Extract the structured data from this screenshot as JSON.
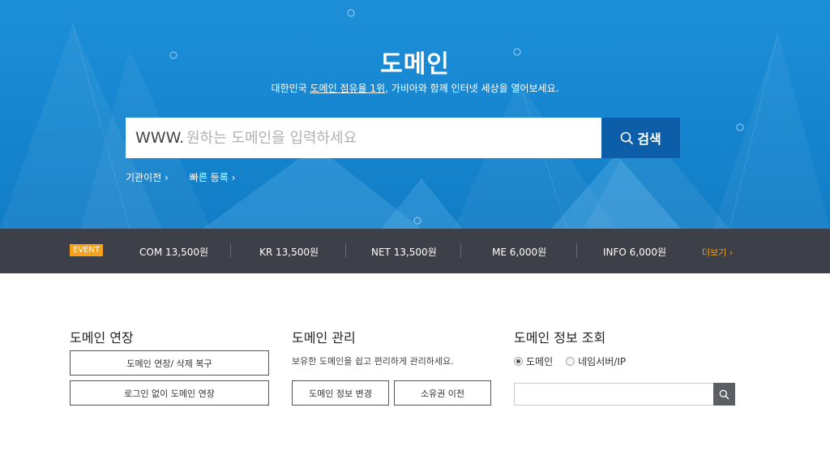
{
  "hero": {
    "title": "도메인",
    "subtitle_pre": "대한민국 ",
    "subtitle_link": "도메인 점유율 1위",
    "subtitle_post": ", 가비아와 함께 인터넷 세상을 열어보세요.",
    "search": {
      "prefix": "WWW.",
      "placeholder": "원하는 도메인을 입력하세요",
      "value": "",
      "button_label": "검색"
    },
    "links": [
      {
        "label": "기관이전 ›"
      },
      {
        "label": "빠른 등록 ›"
      }
    ]
  },
  "price_bar": {
    "badge": "EVENT",
    "items": [
      {
        "label": "COM 13,500원"
      },
      {
        "label": "KR 13,500원"
      },
      {
        "label": "NET 13,500원"
      },
      {
        "label": "ME 6,000원"
      },
      {
        "label": "INFO 6,000원"
      }
    ],
    "more_label": "더보기 ›",
    "colors": {
      "badge": "#f5a11a",
      "background": "#3d4048"
    }
  },
  "sections": {
    "renew": {
      "title": "도메인 연장",
      "buttons": [
        "도메인 연장/ 삭제 복구",
        "로그인 없이 도메인 연장"
      ]
    },
    "manage": {
      "title": "도메인 관리",
      "description": "보유한 도메인을 쉽고 편리하게 관리하세요.",
      "buttons": [
        "도메인 정보 변경",
        "소유권 이전"
      ]
    },
    "lookup": {
      "title": "도메인 정보 조회",
      "radios": [
        {
          "label": "도메인",
          "checked": true
        },
        {
          "label": "네임서버/IP",
          "checked": false
        }
      ],
      "input_value": ""
    }
  },
  "icons": {
    "search": "search-icon",
    "radio": "radio-icon"
  },
  "colors": {
    "hero": "#1585cf",
    "search_button": "#0c5ea8",
    "accent": "#f5a11a"
  }
}
